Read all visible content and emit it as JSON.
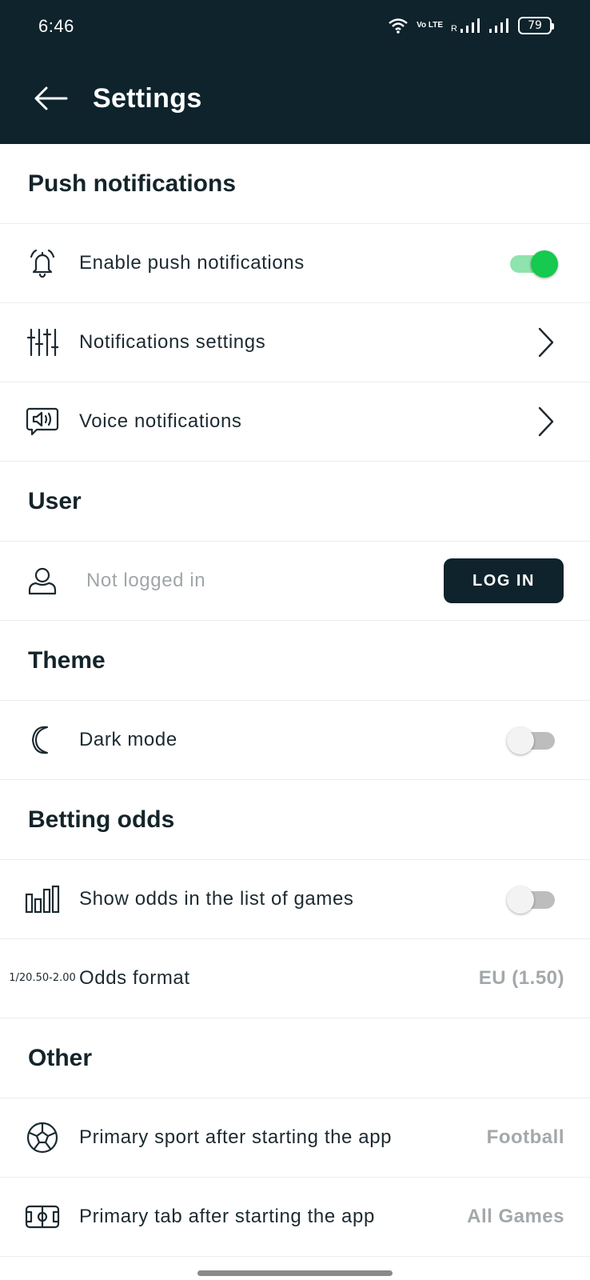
{
  "status_bar": {
    "time": "6:46",
    "battery": "79",
    "network_label": "Vo LTE",
    "roaming": "R"
  },
  "app_bar": {
    "title": "Settings"
  },
  "sections": {
    "push": {
      "header": "Push notifications",
      "enable": {
        "label": "Enable push notifications",
        "enabled": true
      },
      "settings": {
        "label": "Notifications settings"
      },
      "voice": {
        "label": "Voice notifications"
      }
    },
    "user": {
      "header": "User",
      "status": "Not logged in",
      "login_label": "LOG IN"
    },
    "theme": {
      "header": "Theme",
      "dark_mode": {
        "label": "Dark mode",
        "enabled": false
      }
    },
    "odds": {
      "header": "Betting odds",
      "show": {
        "label": "Show odds in the list of games",
        "enabled": false
      },
      "format": {
        "label": "Odds format",
        "value": "EU (1.50)",
        "icon_lines": [
          "1/2",
          "0.50",
          "-2.00"
        ]
      }
    },
    "other": {
      "header": "Other",
      "sport": {
        "label": "Primary sport after starting the app",
        "value": "Football"
      },
      "tab": {
        "label": "Primary tab after starting the app",
        "value": "All Games"
      }
    }
  },
  "colors": {
    "header_bg": "#0e232c",
    "toggle_on": "#16c94f",
    "text": "#1c2a30",
    "muted": "#a3a8ab"
  }
}
